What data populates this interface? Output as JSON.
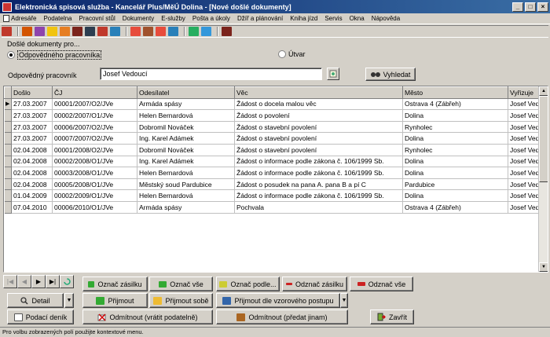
{
  "window": {
    "title": "Elektronická spisová služba - Kancelář Plus/MěÚ Dolina - [Nové došlé dokumenty]"
  },
  "menu": [
    "Adresáře",
    "Podatelna",
    "Pracovní stůl",
    "Dokumenty",
    "E-služby",
    "Pošta a úkoly",
    "Džíř a plánování",
    "Kniha jízd",
    "Servis",
    "Okna",
    "Nápověda"
  ],
  "toolbar": {
    "icons": [
      "users-icon",
      "stamp-icon",
      "people-icon",
      "new-document-icon",
      "envelope-icon",
      "book-icon",
      "window-icon",
      "signature-icon",
      "flag-icon",
      "inbox-icon",
      "grid-icon",
      "calendar-icon",
      "car-icon",
      "globe-icon",
      "printer-icon",
      "exit-icon"
    ],
    "colors": [
      "#c0392b",
      "#d35400",
      "#8e44ad",
      "#f1c40f",
      "#e67e22",
      "#7b241c",
      "#2c3e50",
      "#c0392b",
      "#2980b9",
      "#e74c3c",
      "#a0522d",
      "#e74c3c",
      "#2980b9",
      "#27ae60",
      "#3498db",
      "#7b241c"
    ]
  },
  "filter": {
    "group_caption": "Došlé dokumenty pro...",
    "radio_person": "Odpovědného pracovníka",
    "radio_unit": "Útvar",
    "field_label": "Odpovědný pracovník",
    "field_value": "Josef Vedoucí",
    "search_label": "Vyhledat"
  },
  "table": {
    "columns": [
      "Došlo",
      "ČJ",
      "Odesílatel",
      "Věc",
      "Město",
      "Vyřizuje"
    ],
    "rows": [
      [
        "27.03.2007",
        "00001/2007/O2/JVe",
        "Armáda spásy",
        "Žádost o docela malou věc",
        "Ostrava 4 (Zábřeh)",
        "Josef Ved"
      ],
      [
        "27.03.2007",
        "00002/2007/O1/JVe",
        " Helen Bernardová",
        "Žádost o povolení",
        "Dolina",
        "Josef Ved"
      ],
      [
        "27.03.2007",
        "00006/2007/O2/JVe",
        " Dobromil Nováček",
        "Žádost o stavební povolení",
        "Rynholec",
        "Josef Ved"
      ],
      [
        "27.03.2007",
        "00007/2007/O2/JVe",
        "Ing. Karel Adámek",
        "Žádost o stavební povolení",
        "Dolina",
        "Josef Ved"
      ],
      [
        "02.04.2008",
        "00001/2008/O2/JVe",
        " Dobromil Nováček",
        "Žádost o stavební povolení",
        "Rynholec",
        "Josef Ved"
      ],
      [
        "02.04.2008",
        "00002/2008/O1/JVe",
        "Ing. Karel Adámek",
        "Žádost o informace podle zákona č. 106/1999 Sb.",
        "Dolina",
        "Josef Ved"
      ],
      [
        "02.04.2008",
        "00003/2008/O1/JVe",
        " Helen Bernardová",
        "Žádost o informace podle zákona č. 106/1999 Sb.",
        "Dolina",
        "Josef Ved"
      ],
      [
        "02.04.2008",
        "00005/2008/O1/JVe",
        "Městský soud Pardubice",
        "Žádost o posudek na pana A. pana B a pí C",
        "Pardubice",
        "Josef Ved"
      ],
      [
        "01.04.2009",
        "00002/2009/O1/JVe",
        " Helen Bernardová",
        "Žádost o informace podle zákona č. 106/1999 Sb.",
        "Dolina",
        "Josef Ved"
      ],
      [
        "07.04.2010",
        "00006/2010/O1/JVe",
        "Armáda spásy",
        "Pochvala",
        "Ostrava 4 (Zábřeh)",
        "Josef Ved"
      ]
    ]
  },
  "buttons": {
    "mark_item": "Označ zásilku",
    "mark_all": "Označ vše",
    "mark_by": "Označ podle...",
    "unmark_item": "Odznač zásilku",
    "unmark_all": "Odznač vše",
    "detail": "Detail",
    "accept": "Přijmout",
    "accept_self": "Přijmout sobě",
    "accept_pattern": "Přijmout dle vzorového postupu",
    "journal": "Podací deník",
    "reject_return": "Odmítnout (vrátit podatelně)",
    "reject_forward": "Odmítnout (předat jinam)",
    "close": "Zavřít"
  },
  "status": {
    "text": "Pro volbu zobrazených polí použijte kontextové menu."
  }
}
